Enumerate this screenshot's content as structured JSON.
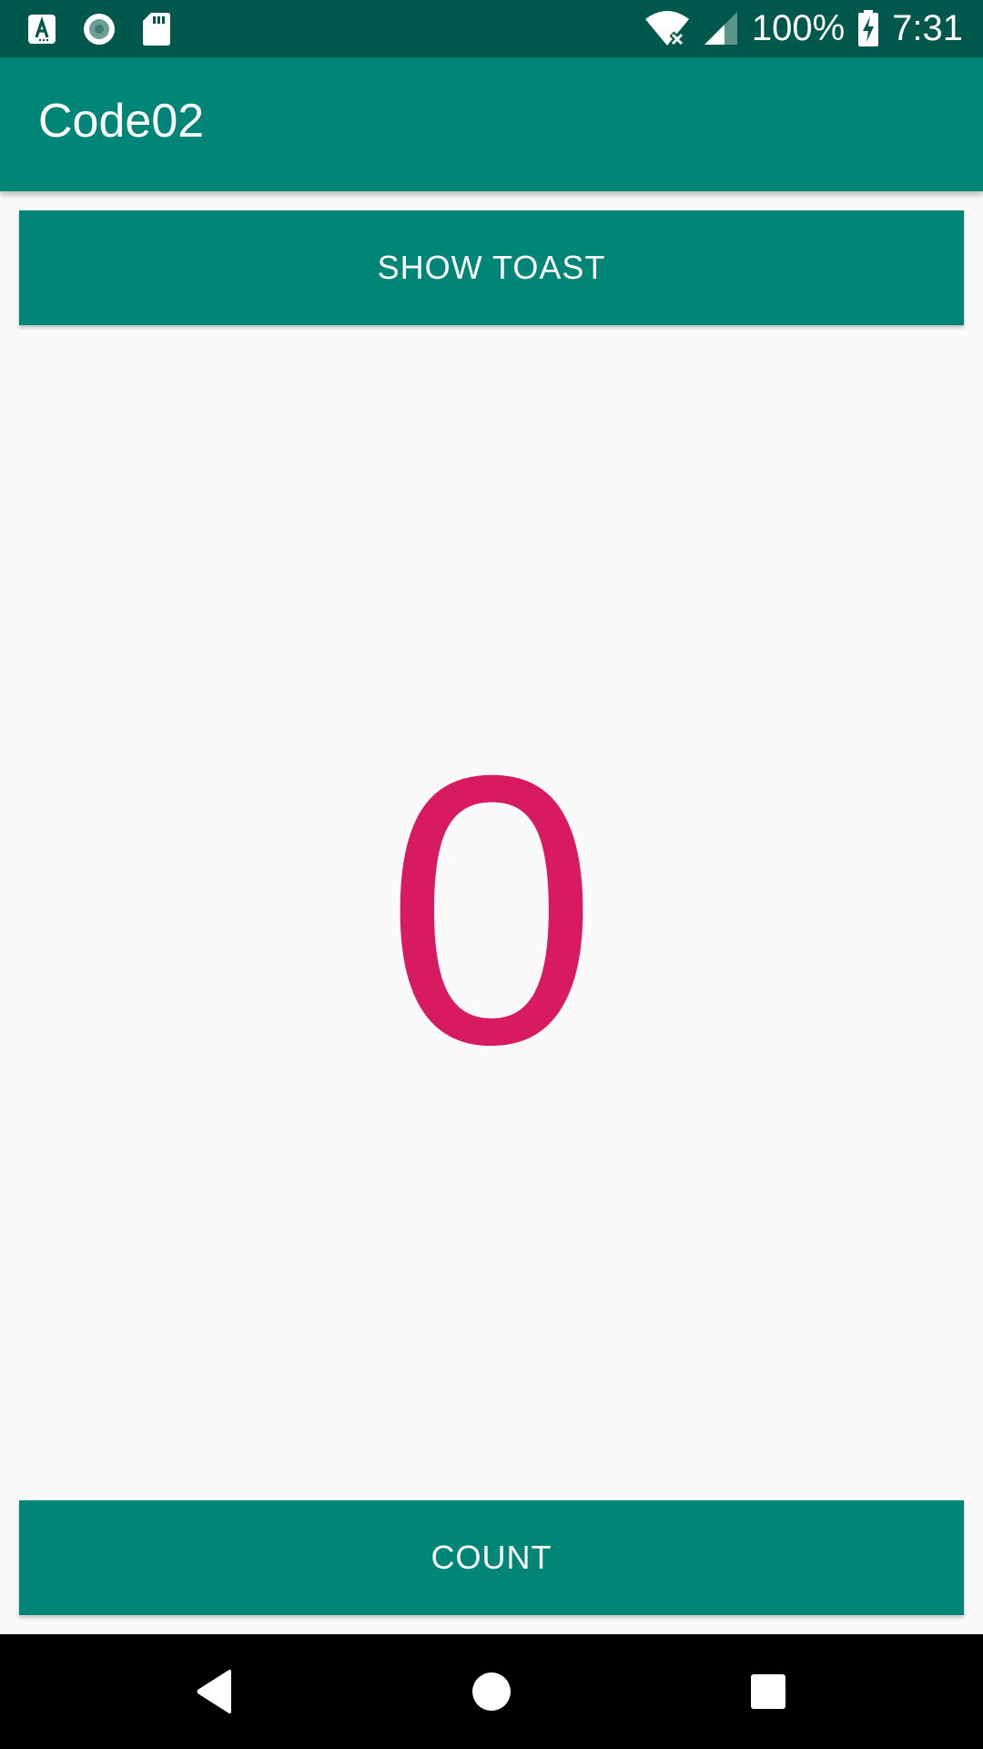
{
  "status_bar": {
    "battery_text": "100%",
    "time": "7:31",
    "icons_left": [
      "accessibility-app-icon",
      "record-icon",
      "sd-card-icon"
    ],
    "icons_right": [
      "wifi-off-icon",
      "signal-icon",
      "battery-charging-icon"
    ]
  },
  "app_bar": {
    "title": "Code02"
  },
  "main": {
    "show_toast_label": "SHOW TOAST",
    "count_value": "0",
    "count_label": "COUNT"
  },
  "nav_bar": {
    "icons": [
      "back-icon",
      "home-icon",
      "recents-icon"
    ]
  },
  "colors": {
    "status_bar": "#00574b",
    "primary": "#008577",
    "accent": "#d81b60",
    "background": "#fafafa"
  }
}
